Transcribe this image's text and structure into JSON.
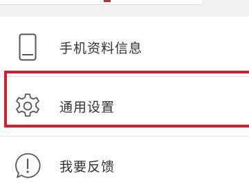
{
  "menu": {
    "items": [
      {
        "label": "手机资料信息",
        "icon": "phone-icon"
      },
      {
        "label": "通用设置",
        "icon": "gear-icon"
      },
      {
        "label": "我要反馈",
        "icon": "feedback-icon"
      }
    ]
  },
  "colors": {
    "highlight": "#d42128",
    "text": "#333333",
    "icon": "#555555"
  }
}
